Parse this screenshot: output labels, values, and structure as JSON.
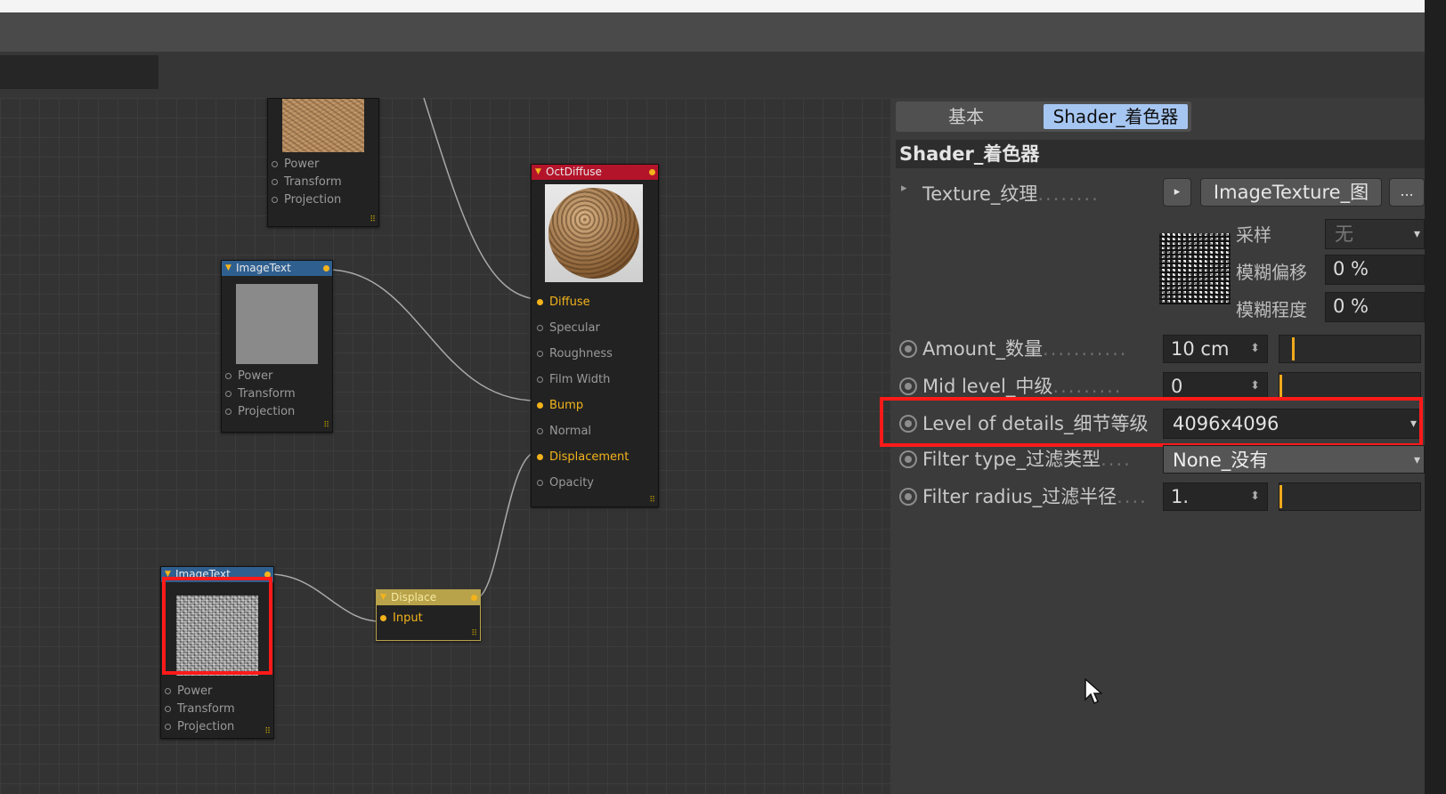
{
  "colors": {
    "accent_orange": "#f3b31c",
    "highlight_red": "#ff1a1a",
    "tab_active": "#a6c6f2",
    "node_header_blue": "#2f5f8f",
    "node_header_red": "#b4142a",
    "node_header_yellow": "#b8a24a"
  },
  "nodes": {
    "image_top": {
      "ports": [
        "Power",
        "Transform",
        "Projection"
      ]
    },
    "image_middle": {
      "title": "ImageText",
      "ports": [
        "Power",
        "Transform",
        "Projection"
      ]
    },
    "image_bottom": {
      "title": "ImageText",
      "ports": [
        "Power",
        "Transform",
        "Projection"
      ]
    },
    "oct_diffuse": {
      "title": "OctDiffuse",
      "ports": [
        "Diffuse",
        "Specular",
        "Roughness",
        "Film Width",
        "Bump",
        "Normal",
        "Displacement",
        "Opacity"
      ]
    },
    "displace": {
      "title": "Displace",
      "ports": [
        "Input"
      ]
    }
  },
  "panel": {
    "tabs": {
      "basic": "基本",
      "shader": "Shader_着色器"
    },
    "section_title": "Shader_着色器",
    "texture": {
      "label": "Texture_纹理",
      "leader": "........",
      "arrow_icon": "▸",
      "value": "ImageTexture_图",
      "more": "..."
    },
    "sampling": {
      "label": "采样",
      "value": "无",
      "blur_offset_label": "模糊偏移",
      "blur_offset_value": "0 %",
      "blur_scale_label": "模糊程度",
      "blur_scale_value": "0 %"
    },
    "amount": {
      "label": "Amount_数量",
      "leader": "...........",
      "value": "10 cm"
    },
    "mid_level": {
      "label": "Mid level_中级",
      "leader": ".........",
      "value": "0"
    },
    "level_of_details": {
      "label": "Level of details_细节等级",
      "value": "4096x4096"
    },
    "filter_type": {
      "label": "Filter type_过滤类型",
      "leader": "....",
      "value": "None_没有"
    },
    "filter_radius": {
      "label": "Filter radius_过滤半径",
      "leader": "....",
      "value": "1."
    }
  }
}
